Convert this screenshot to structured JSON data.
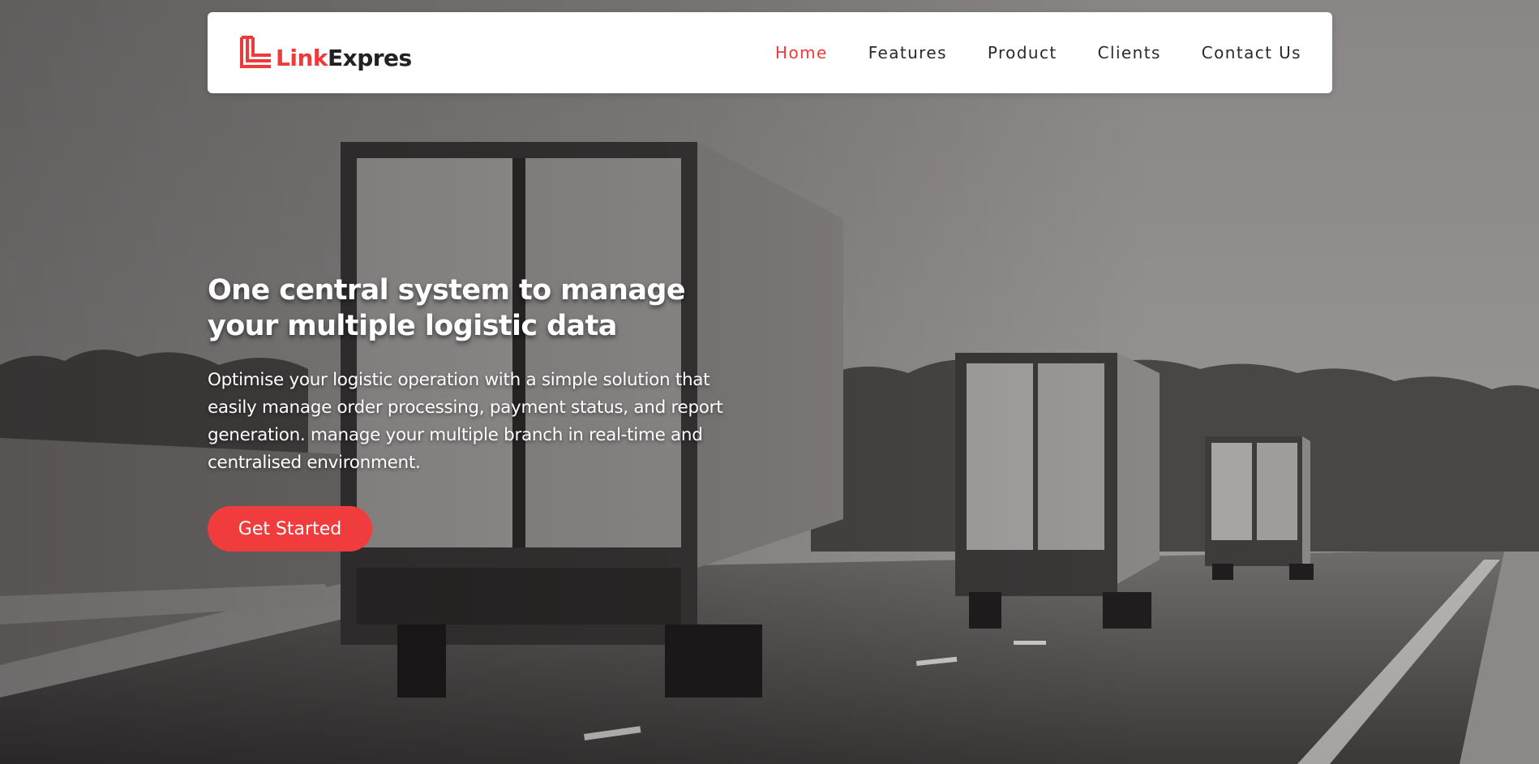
{
  "brand": {
    "name_part1": "Link",
    "name_part2": "Expres",
    "accent_color": "#ee3a3a",
    "logo_icon": "linkexpres-logo-icon"
  },
  "nav": {
    "items": [
      {
        "label": "Home",
        "active": true
      },
      {
        "label": "Features",
        "active": false
      },
      {
        "label": "Product",
        "active": false
      },
      {
        "label": "Clients",
        "active": false
      },
      {
        "label": "Contact Us",
        "active": false
      }
    ]
  },
  "hero": {
    "headline": "One central system to manage your multiple logistic data",
    "subtext": "Optimise your logistic operation with a simple solution that easily manage order processing, payment status, and report generation. manage your multiple branch in real-time and centralised environment.",
    "cta_label": "Get Started",
    "background_image": "trucks-on-highway-photo"
  }
}
